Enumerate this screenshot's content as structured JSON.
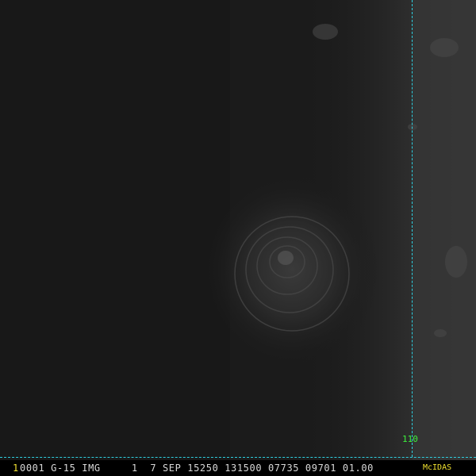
{
  "image": {
    "description_hidden": "",
    "colors": {
      "background": "#1a1a1a",
      "grid_line": "#2ecfe0",
      "lon_label": "#3cf03c",
      "frame_number": "#f0e030",
      "status_text": "#d8d8d8",
      "logo": "#f0e030"
    }
  },
  "overlay": {
    "longitude_label": "110"
  },
  "status_bar": {
    "frame_number": "1",
    "header": "0001 G-15 IMG     1  7 SEP 15250 131500 07735 09701 01.00",
    "logo": "McIDAS"
  }
}
